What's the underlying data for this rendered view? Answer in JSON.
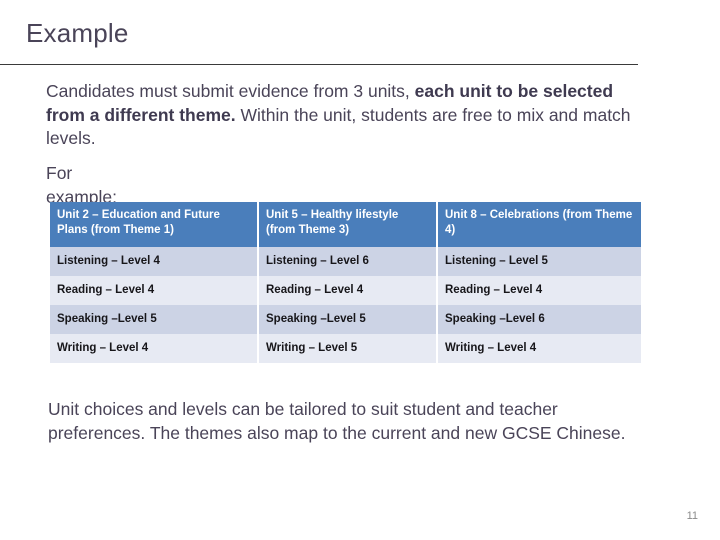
{
  "slide": {
    "title": "Example",
    "page_number": "11",
    "accent_header_color": "#4a7ebb",
    "text_color": "#4a4458",
    "row_color_odd": "#ccd3e5",
    "row_color_even": "#e7eaf3"
  },
  "intro": {
    "part_1": "Candidates must submit evidence from 3 units, ",
    "bold": "each unit to be selected from a different theme.",
    "part_2": " Within the unit, students are free to mix and match levels."
  },
  "for_example_label": "For example:",
  "table": {
    "headers": [
      "Unit 2 – Education and Future Plans (from Theme 1)",
      "Unit 5 – Healthy lifestyle (from Theme 3)",
      "Unit 8 – Celebrations (from Theme 4)"
    ],
    "rows": [
      [
        "Listening – Level 4",
        "Listening – Level 6",
        "Listening – Level 5"
      ],
      [
        "Reading – Level 4",
        "Reading – Level 4",
        "Reading – Level 4"
      ],
      [
        "Speaking –Level 5",
        "Speaking –Level 5",
        "Speaking –Level 6"
      ],
      [
        "Writing – Level 4",
        "Writing – Level 5",
        "Writing – Level 4"
      ]
    ]
  },
  "closing": "Unit choices and levels can be tailored to suit student and teacher preferences. The themes also map to the current and new GCSE Chinese."
}
